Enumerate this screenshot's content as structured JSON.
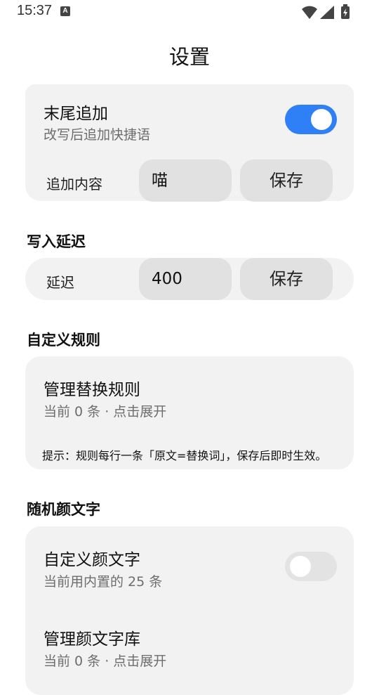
{
  "status_bar": {
    "time": "15:37",
    "notification_icon": "A"
  },
  "header": {
    "title": "设置"
  },
  "append_card": {
    "title": "末尾追加",
    "subtitle": "改写后追加快捷语",
    "toggle_on": true,
    "field_label": "追加内容",
    "field_value": "喵",
    "save_label": "保存"
  },
  "delay_section": {
    "title": "写入延迟",
    "field_label": "延迟",
    "field_value": "400",
    "save_label": "保存"
  },
  "rules_section": {
    "title": "自定义规则",
    "manage_title": "管理替换规则",
    "manage_sub": "当前 0 条 · 点击展开",
    "hint": "提示：规则每行一条「原文=替换词」，保存后即时生效。"
  },
  "kaomoji_section": {
    "title": "随机颜文字",
    "custom_title": "自定义颜文字",
    "custom_sub": "当前用内置的 25 条",
    "custom_toggle_on": false,
    "library_title": "管理颜文字库",
    "library_sub": "当前 0 条 · 点击展开"
  },
  "colors": {
    "accent": "#2f7ff6",
    "card_bg": "#f2f2f2",
    "input_bg": "#e1e1e1"
  }
}
